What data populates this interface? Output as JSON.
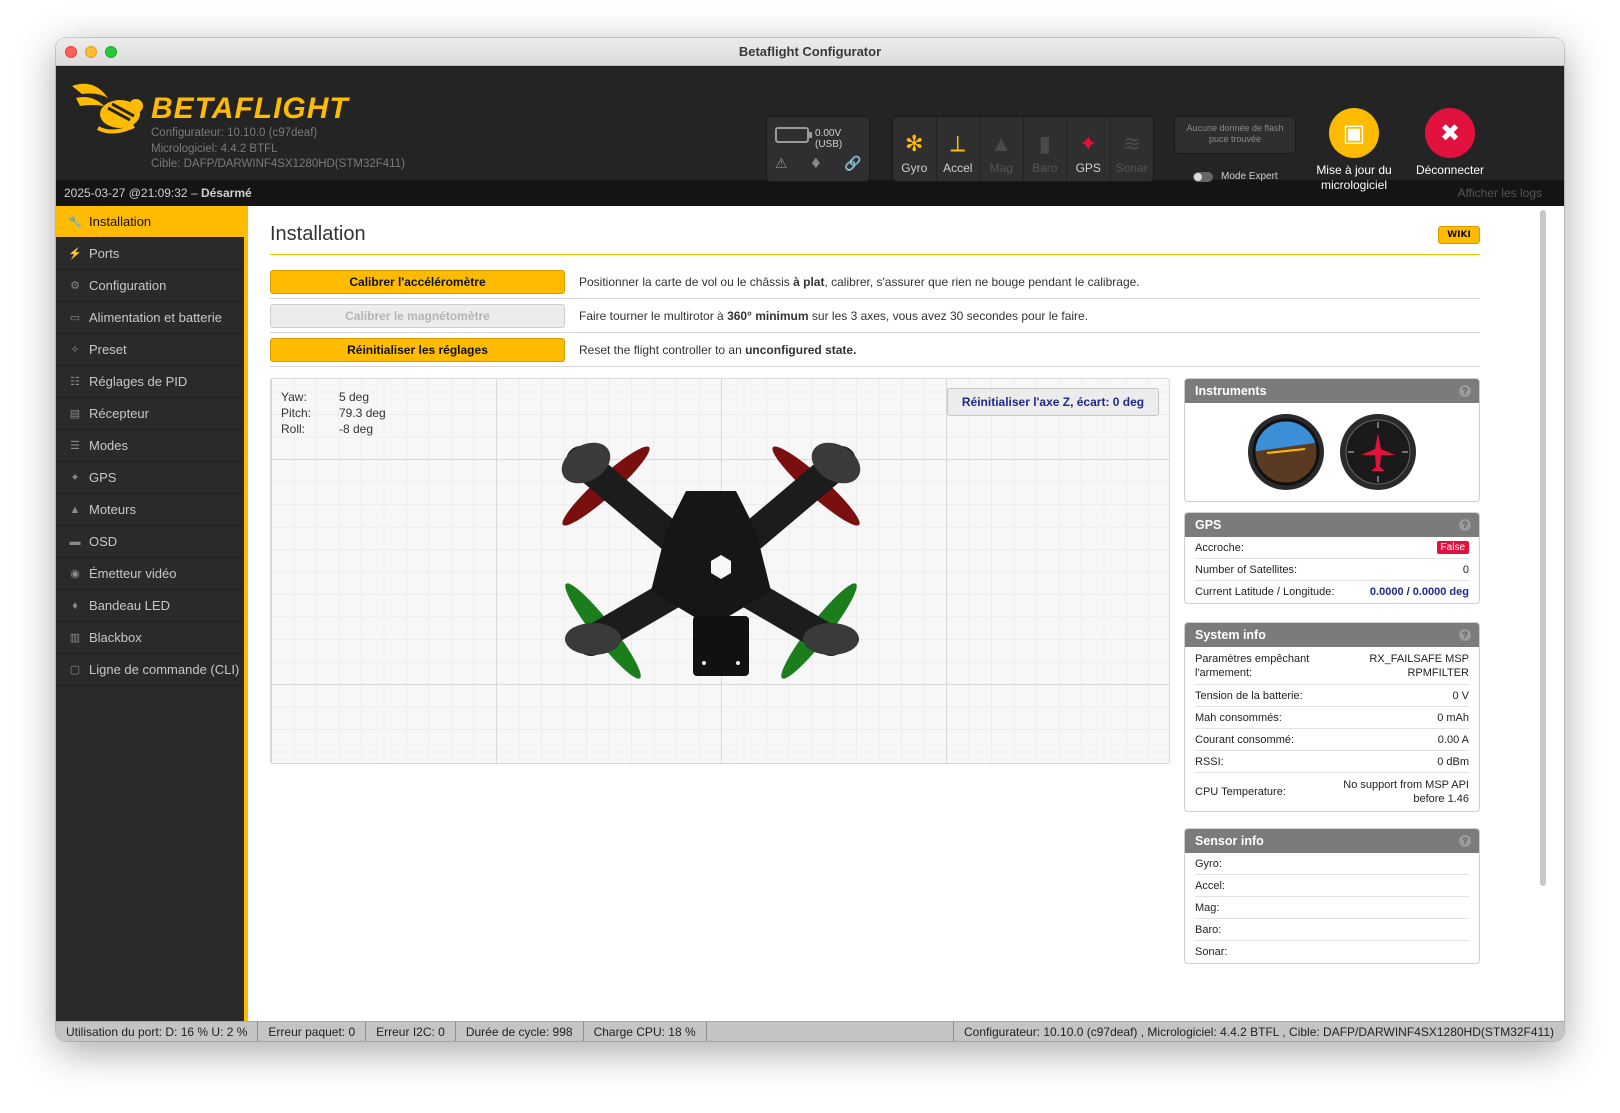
{
  "window": {
    "title": "Betaflight Configurator"
  },
  "brand": {
    "name": "BETAFLIGHT",
    "configurator": "Configurateur: 10.10.0 (c97deaf)",
    "firmware": "Micrologiciel: 4.4.2 BTFL",
    "target": "Cible: DAFP/DARWINF4SX1280HD(STM32F411)"
  },
  "battery": {
    "voltage": "0.00V (USB)"
  },
  "sensors": [
    {
      "label": "Gyro",
      "active": true
    },
    {
      "label": "Accel",
      "active": true
    },
    {
      "label": "Mag",
      "active": false
    },
    {
      "label": "Baro",
      "active": false
    },
    {
      "label": "GPS",
      "active": true
    },
    {
      "label": "Sonar",
      "active": false
    }
  ],
  "flash": {
    "line1": "Aucune donnée de flash",
    "line2": "puce trouvée"
  },
  "expert_mode": {
    "label": "Mode Expert",
    "enabled": false
  },
  "header_buttons": {
    "update_line1": "Mise à jour du",
    "update_line2": "micrologiciel",
    "disconnect": "Déconnecter"
  },
  "status_top": {
    "datetime": "2025-03-27 @21:09:32 –",
    "armed": "Désarmé",
    "show_logs": "Afficher les logs"
  },
  "sidebar": {
    "items": [
      {
        "label": "Installation",
        "icon": "wrench-icon"
      },
      {
        "label": "Ports",
        "icon": "plug-icon"
      },
      {
        "label": "Configuration",
        "icon": "gear-icon"
      },
      {
        "label": "Alimentation et batterie",
        "icon": "battery-icon"
      },
      {
        "label": "Preset",
        "icon": "magic-wand-icon"
      },
      {
        "label": "Réglages de PID",
        "icon": "sliders-icon"
      },
      {
        "label": "Récepteur",
        "icon": "receiver-icon"
      },
      {
        "label": "Modes",
        "icon": "toggles-icon"
      },
      {
        "label": "GPS",
        "icon": "satellite-icon"
      },
      {
        "label": "Moteurs",
        "icon": "motor-icon"
      },
      {
        "label": "OSD",
        "icon": "osd-icon"
      },
      {
        "label": "Émetteur vidéo",
        "icon": "broadcast-icon"
      },
      {
        "label": "Bandeau LED",
        "icon": "led-icon"
      },
      {
        "label": "Blackbox",
        "icon": "blackbox-icon"
      },
      {
        "label": "Ligne de commande (CLI)",
        "icon": "terminal-icon"
      }
    ]
  },
  "page": {
    "title": "Installation",
    "wiki": "WIKI"
  },
  "actions": [
    {
      "button": "Calibrer l'accéléromètre",
      "enabled": true,
      "desc_before": "Positionner la carte de vol ou le châssis ",
      "desc_bold": "à plat",
      "desc_after": ", calibrer, s'assurer que rien ne bouge pendant le calibrage."
    },
    {
      "button": "Calibrer le magnétomètre",
      "enabled": false,
      "desc_before": "Faire tourner le multirotor à ",
      "desc_bold": "360° minimum",
      "desc_after": " sur les 3 axes, vous avez 30 secondes pour le faire."
    },
    {
      "button": "Réinitialiser les réglages",
      "enabled": true,
      "desc_before": "Reset the flight controller to an ",
      "desc_bold": "unconfigured state.",
      "desc_after": ""
    }
  ],
  "attitude": {
    "yaw_label": "Yaw:",
    "yaw": "5 deg",
    "pitch_label": "Pitch:",
    "pitch": "79.3 deg",
    "roll_label": "Roll:",
    "roll": "-8 deg"
  },
  "reset_z": "Réinitialiser l'axe Z, écart: 0 deg",
  "instruments": {
    "title": "Instruments"
  },
  "gps": {
    "title": "GPS",
    "fix_label": "Accroche:",
    "fix": "False",
    "sats_label": "Number of Satellites:",
    "sats": "0",
    "latlon_label": "Current Latitude / Longitude:",
    "latlon": "0.0000 / 0.0000 deg"
  },
  "system_info": {
    "title": "System info",
    "arming_label": "Paramètres empêchant l'armement:",
    "arming": "RX_FAILSAFE  MSP RPMFILTER",
    "battery_label": "Tension de la batterie:",
    "battery": "0 V",
    "mah_label": "Mah consommés:",
    "mah": "0 mAh",
    "current_label": "Courant consommé:",
    "current": "0.00 A",
    "rssi_label": "RSSI:",
    "rssi": "0 dBm",
    "cpu_label": "CPU Temperature:",
    "cpu": "No support from MSP API before 1.46"
  },
  "sensor_info": {
    "title": "Sensor info",
    "gyro": "Gyro:",
    "accel": "Accel:",
    "mag": "Mag:",
    "baro": "Baro:",
    "sonar": "Sonar:"
  },
  "footer": {
    "port": "Utilisation du port: D: 16 % U: 2 %",
    "packet": "Erreur paquet: 0",
    "i2c": "Erreur I2C: 0",
    "cycle": "Durée de cycle: 998",
    "cpu": "Charge CPU: 18 %",
    "version": "Configurateur: 10.10.0 (c97deaf) , Micrologiciel: 4.4.2 BTFL , Cible: DAFP/DARWINF4SX1280HD(STM32F411)"
  },
  "colors": {
    "accent": "#ffbb00",
    "danger": "#e2123f",
    "dark": "#242424"
  }
}
